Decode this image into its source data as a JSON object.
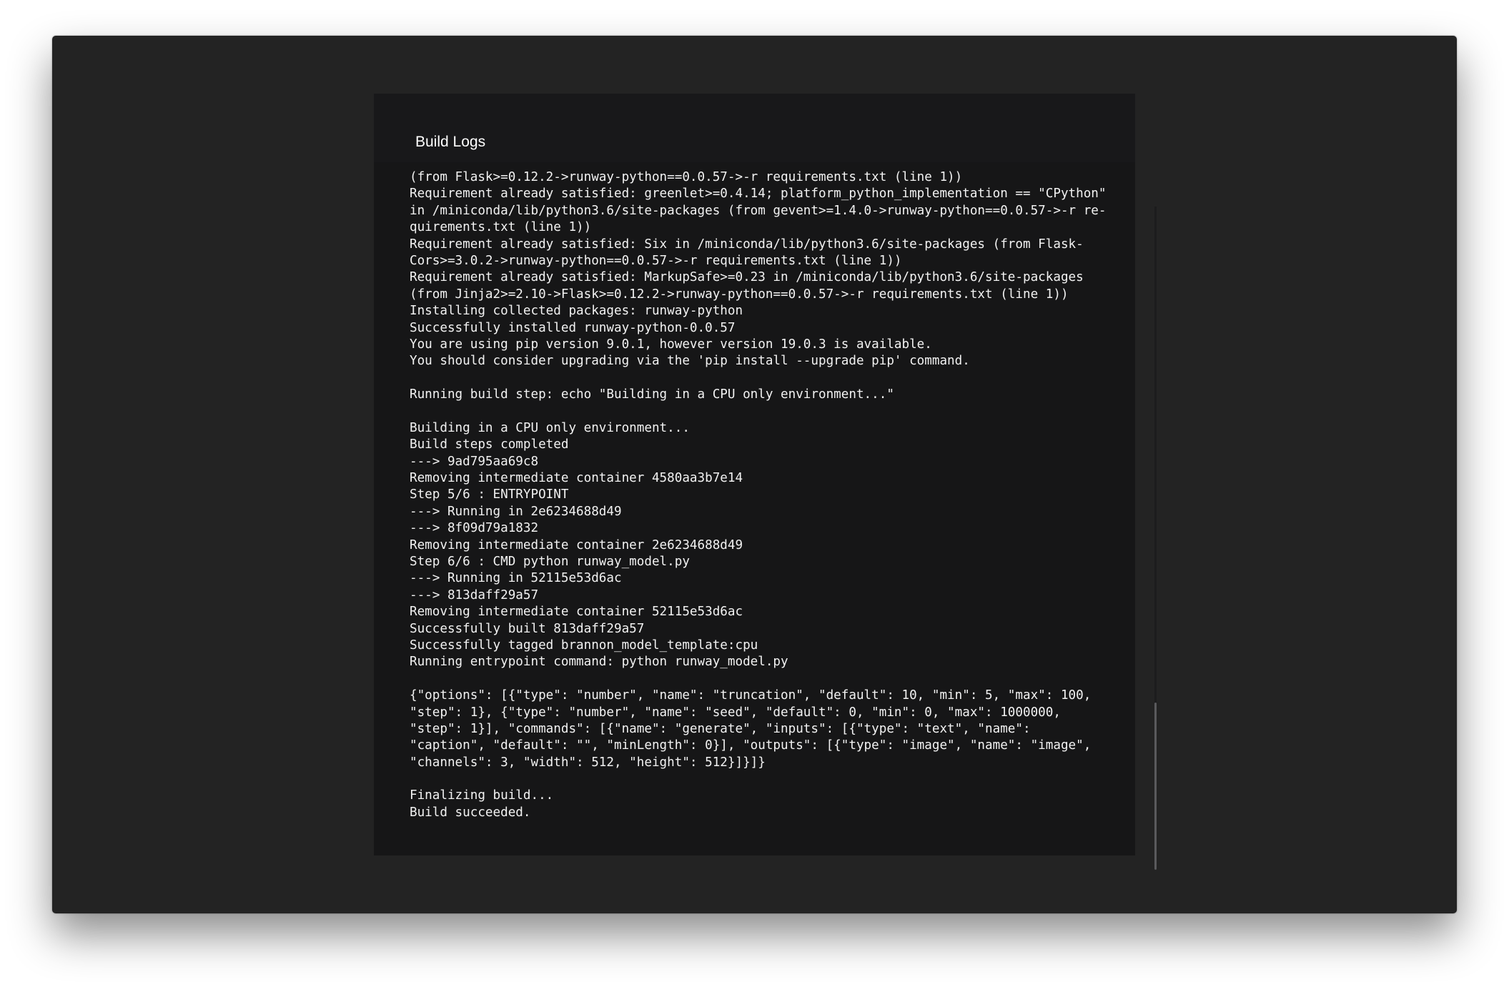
{
  "panel": {
    "title": "Build Logs"
  },
  "logs": {
    "lines": [
      "(from Flask>=0.12.2->runway-python==0.0.57->-r requirements.txt (line 1))",
      "Requirement already satisfied: greenlet>=0.4.14; platform_python_implementation == \"CPython\"",
      "in /miniconda/lib/python3.6/site-packages (from gevent>=1.4.0->runway-python==0.0.57->-r re-",
      "quirements.txt (line 1))",
      "Requirement already satisfied: Six in /miniconda/lib/python3.6/site-packages (from Flask-",
      "Cors>=3.0.2->runway-python==0.0.57->-r requirements.txt (line 1))",
      "Requirement already satisfied: MarkupSafe>=0.23 in /miniconda/lib/python3.6/site-packages",
      "(from Jinja2>=2.10->Flask>=0.12.2->runway-python==0.0.57->-r requirements.txt (line 1))",
      "Installing collected packages: runway-python",
      "Successfully installed runway-python-0.0.57",
      "You are using pip version 9.0.1, however version 19.0.3 is available.",
      "You should consider upgrading via the 'pip install --upgrade pip' command.",
      "",
      "Running build step: echo \"Building in a CPU only environment...\"",
      "",
      "Building in a CPU only environment...",
      "Build steps completed",
      "---> 9ad795aa69c8",
      "Removing intermediate container 4580aa3b7e14",
      "Step 5/6 : ENTRYPOINT",
      "---> Running in 2e6234688d49",
      "---> 8f09d79a1832",
      "Removing intermediate container 2e6234688d49",
      "Step 6/6 : CMD python runway_model.py",
      "---> Running in 52115e53d6ac",
      "---> 813daff29a57",
      "Removing intermediate container 52115e53d6ac",
      "Successfully built 813daff29a57",
      "Successfully tagged brannon_model_template:cpu",
      "Running entrypoint command: python runway_model.py",
      "",
      "{\"options\": [{\"type\": \"number\", \"name\": \"truncation\", \"default\": 10, \"min\": 5, \"max\": 100,",
      "\"step\": 1}, {\"type\": \"number\", \"name\": \"seed\", \"default\": 0, \"min\": 0, \"max\": 1000000,",
      "\"step\": 1}], \"commands\": [{\"name\": \"generate\", \"inputs\": [{\"type\": \"text\", \"name\":",
      "\"caption\", \"default\": \"\", \"minLength\": 0}], \"outputs\": [{\"type\": \"image\", \"name\": \"image\",",
      "\"channels\": 3, \"width\": 512, \"height\": 512}]}]}",
      "",
      "Finalizing build...",
      "Build succeeded."
    ]
  }
}
